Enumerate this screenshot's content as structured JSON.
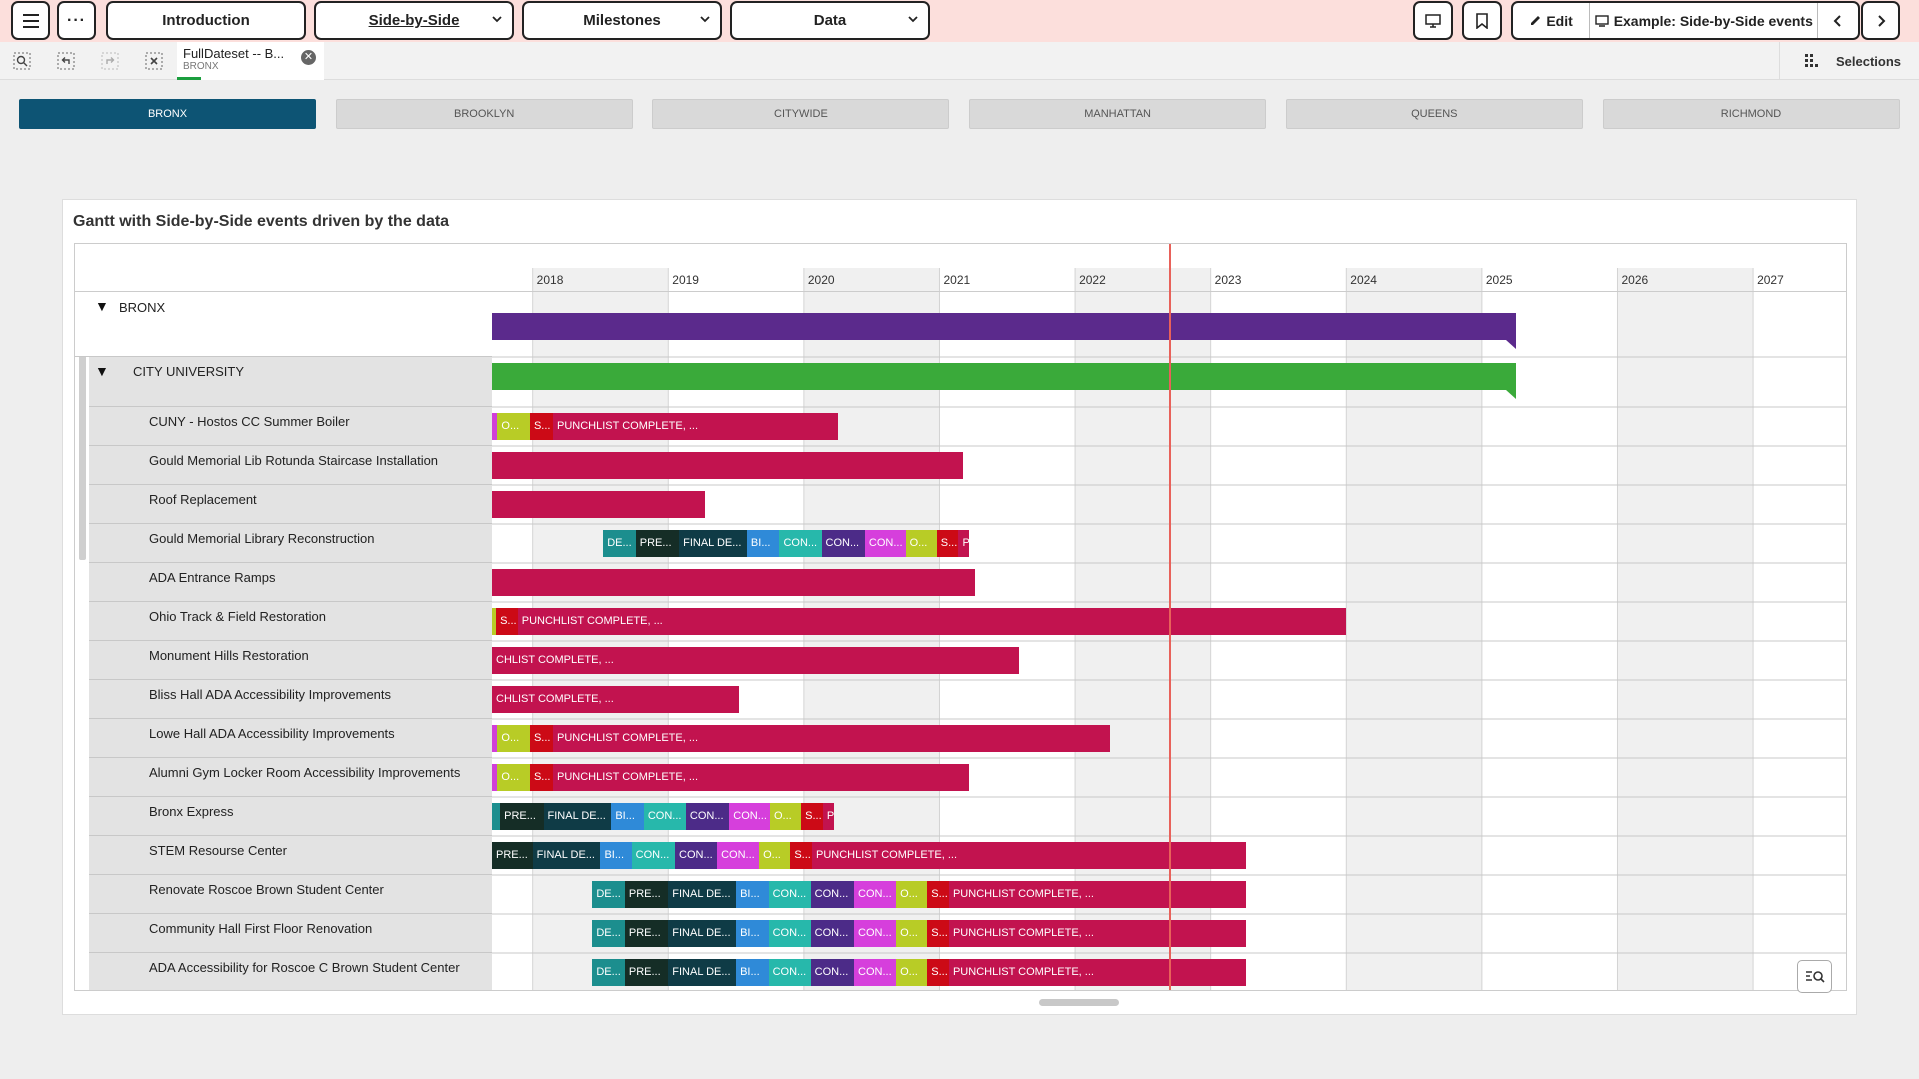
{
  "toolbar": {
    "menu_icon": "hamburger-icon",
    "more_icon": "ellipsis-icon",
    "sheets": [
      {
        "label": "Introduction"
      },
      {
        "label": "Side-by-Side"
      },
      {
        "label": "Milestones"
      },
      {
        "label": "Data"
      }
    ],
    "edit_label": "Edit",
    "example_label": "Example: Side-by-Side events"
  },
  "selection_bar": {
    "chip_title": "FullDateset -- B...",
    "chip_value": "BRONX",
    "selections_label": "Selections"
  },
  "boroughs": [
    "BRONX",
    "BROOKLYN",
    "CITYWIDE",
    "MANHATTAN",
    "QUEENS",
    "RICHMOND"
  ],
  "active_borough": "BRONX",
  "panel": {
    "title": "Gantt with Side-by-Side events driven by the data"
  },
  "chart_data": {
    "type": "gantt",
    "x_axis_years": [
      "2018",
      "2019",
      "2020",
      "2021",
      "2022",
      "2023",
      "2024",
      "2025",
      "2026",
      "2027"
    ],
    "x_range": [
      2017.7,
      2027.7
    ],
    "today": 2022.7,
    "colors": {
      "bronx": "#5b2a8c",
      "city_university": "#3aaa3a",
      "punchlist": "#c2134f",
      "olive": "#b8cc26",
      "red_s": "#cc0a16",
      "magenta": "#d13fd8",
      "teal_de": "#1c8e8e",
      "dark_pre": "#152d26",
      "navy_final": "#0f3b46",
      "blue_bi": "#2f8ad8",
      "turq_con": "#27b8ab",
      "purple_con": "#4c2b88",
      "pink_con": "#d63fdc"
    },
    "groups": [
      {
        "label": "BRONX",
        "start": 2017.7,
        "end": 2025.25
      },
      {
        "label": "CITY UNIVERSITY",
        "start": 2017.7,
        "end": 2025.25
      }
    ],
    "rows": [
      {
        "label": "CUNY - Hostos CC Summer Boiler",
        "segments": [
          {
            "t": "",
            "s": 2017.7,
            "e": 2017.74,
            "c": "magenta"
          },
          {
            "t": "O...",
            "s": 2017.74,
            "e": 2017.98,
            "c": "olive"
          },
          {
            "t": "S...",
            "s": 2017.98,
            "e": 2018.15,
            "c": "red_s"
          },
          {
            "t": "PUNCHLIST COMPLETE, ...",
            "s": 2018.15,
            "e": 2020.25,
            "c": "punchlist"
          }
        ]
      },
      {
        "label": "Gould Memorial Lib Rotunda Staircase Installation",
        "segments": [
          {
            "t": "",
            "s": 2017.7,
            "e": 2021.17,
            "c": "punchlist"
          }
        ]
      },
      {
        "label": "Roof Replacement",
        "segments": [
          {
            "t": "",
            "s": 2017.7,
            "e": 2019.27,
            "c": "punchlist"
          }
        ]
      },
      {
        "label": "Gould Memorial Library Reconstruction",
        "segments": [
          {
            "t": "DE...",
            "s": 2018.52,
            "e": 2018.76,
            "c": "teal_de"
          },
          {
            "t": "PRE...",
            "s": 2018.76,
            "e": 2019.08,
            "c": "dark_pre"
          },
          {
            "t": "FINAL DE...",
            "s": 2019.08,
            "e": 2019.58,
            "c": "navy_final"
          },
          {
            "t": "BI...",
            "s": 2019.58,
            "e": 2019.82,
            "c": "blue_bi"
          },
          {
            "t": "CON...",
            "s": 2019.82,
            "e": 2020.13,
            "c": "turq_con"
          },
          {
            "t": "CON...",
            "s": 2020.13,
            "e": 2020.45,
            "c": "purple_con"
          },
          {
            "t": "CON...",
            "s": 2020.45,
            "e": 2020.75,
            "c": "pink_con"
          },
          {
            "t": "O...",
            "s": 2020.75,
            "e": 2020.98,
            "c": "olive"
          },
          {
            "t": "S...",
            "s": 2020.98,
            "e": 2021.14,
            "c": "red_s"
          },
          {
            "t": "P",
            "s": 2021.14,
            "e": 2021.22,
            "c": "punchlist"
          }
        ]
      },
      {
        "label": "ADA Entrance Ramps",
        "segments": [
          {
            "t": "",
            "s": 2017.7,
            "e": 2021.26,
            "c": "punchlist"
          }
        ]
      },
      {
        "label": "Ohio Track & Field Restoration",
        "segments": [
          {
            "t": "",
            "s": 2017.7,
            "e": 2017.73,
            "c": "olive"
          },
          {
            "t": "S...",
            "s": 2017.73,
            "e": 2017.89,
            "c": "red_s"
          },
          {
            "t": "PUNCHLIST COMPLETE, ...",
            "s": 2017.89,
            "e": 2024.0,
            "c": "punchlist"
          }
        ]
      },
      {
        "label": "Monument Hills Restoration",
        "segments": [
          {
            "t": "CHLIST COMPLETE, ...",
            "s": 2017.7,
            "e": 2021.59,
            "c": "punchlist"
          }
        ]
      },
      {
        "label": "Bliss Hall ADA Accessibility Improvements",
        "segments": [
          {
            "t": "CHLIST COMPLETE, ...",
            "s": 2017.7,
            "e": 2019.52,
            "c": "punchlist"
          }
        ]
      },
      {
        "label": "Lowe Hall ADA Accessibility Improvements",
        "segments": [
          {
            "t": "",
            "s": 2017.7,
            "e": 2017.74,
            "c": "magenta"
          },
          {
            "t": "O...",
            "s": 2017.74,
            "e": 2017.98,
            "c": "olive"
          },
          {
            "t": "S...",
            "s": 2017.98,
            "e": 2018.15,
            "c": "red_s"
          },
          {
            "t": "PUNCHLIST COMPLETE, ...",
            "s": 2018.15,
            "e": 2022.26,
            "c": "punchlist"
          }
        ]
      },
      {
        "label": "Alumni Gym Locker Room Accessibility Improvements",
        "segments": [
          {
            "t": "",
            "s": 2017.7,
            "e": 2017.74,
            "c": "magenta"
          },
          {
            "t": "O...",
            "s": 2017.74,
            "e": 2017.98,
            "c": "olive"
          },
          {
            "t": "S...",
            "s": 2017.98,
            "e": 2018.15,
            "c": "red_s"
          },
          {
            "t": "PUNCHLIST COMPLETE, ...",
            "s": 2018.15,
            "e": 2021.22,
            "c": "punchlist"
          }
        ]
      },
      {
        "label": "Bronx Express",
        "segments": [
          {
            "t": "",
            "s": 2017.7,
            "e": 2017.76,
            "c": "teal_de"
          },
          {
            "t": "PRE...",
            "s": 2017.76,
            "e": 2018.08,
            "c": "dark_pre"
          },
          {
            "t": "FINAL DE...",
            "s": 2018.08,
            "e": 2018.58,
            "c": "navy_final"
          },
          {
            "t": "BI...",
            "s": 2018.58,
            "e": 2018.82,
            "c": "blue_bi"
          },
          {
            "t": "CON...",
            "s": 2018.82,
            "e": 2019.13,
            "c": "turq_con"
          },
          {
            "t": "CON...",
            "s": 2019.13,
            "e": 2019.45,
            "c": "purple_con"
          },
          {
            "t": "CON...",
            "s": 2019.45,
            "e": 2019.75,
            "c": "pink_con"
          },
          {
            "t": "O...",
            "s": 2019.75,
            "e": 2019.98,
            "c": "olive"
          },
          {
            "t": "S...",
            "s": 2019.98,
            "e": 2020.14,
            "c": "red_s"
          },
          {
            "t": "P",
            "s": 2020.14,
            "e": 2020.22,
            "c": "punchlist"
          }
        ]
      },
      {
        "label": "STEM Resourse Center",
        "segments": [
          {
            "t": "PRE...",
            "s": 2017.7,
            "e": 2018.0,
            "c": "dark_pre"
          },
          {
            "t": "FINAL DE...",
            "s": 2018.0,
            "e": 2018.5,
            "c": "navy_final"
          },
          {
            "t": "BI...",
            "s": 2018.5,
            "e": 2018.73,
            "c": "blue_bi"
          },
          {
            "t": "CON...",
            "s": 2018.73,
            "e": 2019.05,
            "c": "turq_con"
          },
          {
            "t": "CON...",
            "s": 2019.05,
            "e": 2019.36,
            "c": "purple_con"
          },
          {
            "t": "CON...",
            "s": 2019.36,
            "e": 2019.67,
            "c": "pink_con"
          },
          {
            "t": "O...",
            "s": 2019.67,
            "e": 2019.9,
            "c": "olive"
          },
          {
            "t": "S...",
            "s": 2019.9,
            "e": 2020.06,
            "c": "red_s"
          },
          {
            "t": "PUNCHLIST COMPLETE, ...",
            "s": 2020.06,
            "e": 2023.26,
            "c": "punchlist"
          }
        ]
      },
      {
        "label": "Renovate Roscoe Brown Student Center",
        "segments": [
          {
            "t": "DE...",
            "s": 2018.44,
            "e": 2018.68,
            "c": "teal_de"
          },
          {
            "t": "PRE...",
            "s": 2018.68,
            "e": 2019.0,
            "c": "dark_pre"
          },
          {
            "t": "FINAL DE...",
            "s": 2019.0,
            "e": 2019.5,
            "c": "navy_final"
          },
          {
            "t": "BI...",
            "s": 2019.5,
            "e": 2019.74,
            "c": "blue_bi"
          },
          {
            "t": "CON...",
            "s": 2019.74,
            "e": 2020.05,
            "c": "turq_con"
          },
          {
            "t": "CON...",
            "s": 2020.05,
            "e": 2020.37,
            "c": "purple_con"
          },
          {
            "t": "CON...",
            "s": 2020.37,
            "e": 2020.68,
            "c": "pink_con"
          },
          {
            "t": "O...",
            "s": 2020.68,
            "e": 2020.91,
            "c": "olive"
          },
          {
            "t": "S...",
            "s": 2020.91,
            "e": 2021.07,
            "c": "red_s"
          },
          {
            "t": "PUNCHLIST COMPLETE, ...",
            "s": 2021.07,
            "e": 2023.26,
            "c": "punchlist"
          }
        ]
      },
      {
        "label": "Community Hall First Floor Renovation",
        "segments": [
          {
            "t": "DE...",
            "s": 2018.44,
            "e": 2018.68,
            "c": "teal_de"
          },
          {
            "t": "PRE...",
            "s": 2018.68,
            "e": 2019.0,
            "c": "dark_pre"
          },
          {
            "t": "FINAL DE...",
            "s": 2019.0,
            "e": 2019.5,
            "c": "navy_final"
          },
          {
            "t": "BI...",
            "s": 2019.5,
            "e": 2019.74,
            "c": "blue_bi"
          },
          {
            "t": "CON...",
            "s": 2019.74,
            "e": 2020.05,
            "c": "turq_con"
          },
          {
            "t": "CON...",
            "s": 2020.05,
            "e": 2020.37,
            "c": "purple_con"
          },
          {
            "t": "CON...",
            "s": 2020.37,
            "e": 2020.68,
            "c": "pink_con"
          },
          {
            "t": "O...",
            "s": 2020.68,
            "e": 2020.91,
            "c": "olive"
          },
          {
            "t": "S...",
            "s": 2020.91,
            "e": 2021.07,
            "c": "red_s"
          },
          {
            "t": "PUNCHLIST COMPLETE, ...",
            "s": 2021.07,
            "e": 2023.26,
            "c": "punchlist"
          }
        ]
      },
      {
        "label": "ADA Accessibility for Roscoe C Brown Student Center",
        "segments": [
          {
            "t": "DE...",
            "s": 2018.44,
            "e": 2018.68,
            "c": "teal_de"
          },
          {
            "t": "PRE...",
            "s": 2018.68,
            "e": 2019.0,
            "c": "dark_pre"
          },
          {
            "t": "FINAL DE...",
            "s": 2019.0,
            "e": 2019.5,
            "c": "navy_final"
          },
          {
            "t": "BI...",
            "s": 2019.5,
            "e": 2019.74,
            "c": "blue_bi"
          },
          {
            "t": "CON...",
            "s": 2019.74,
            "e": 2020.05,
            "c": "turq_con"
          },
          {
            "t": "CON...",
            "s": 2020.05,
            "e": 2020.37,
            "c": "purple_con"
          },
          {
            "t": "CON...",
            "s": 2020.37,
            "e": 2020.68,
            "c": "pink_con"
          },
          {
            "t": "O...",
            "s": 2020.68,
            "e": 2020.91,
            "c": "olive"
          },
          {
            "t": "S...",
            "s": 2020.91,
            "e": 2021.07,
            "c": "red_s"
          },
          {
            "t": "PUNCHLIST COMPLETE, ...",
            "s": 2021.07,
            "e": 2023.26,
            "c": "punchlist"
          }
        ]
      }
    ]
  }
}
